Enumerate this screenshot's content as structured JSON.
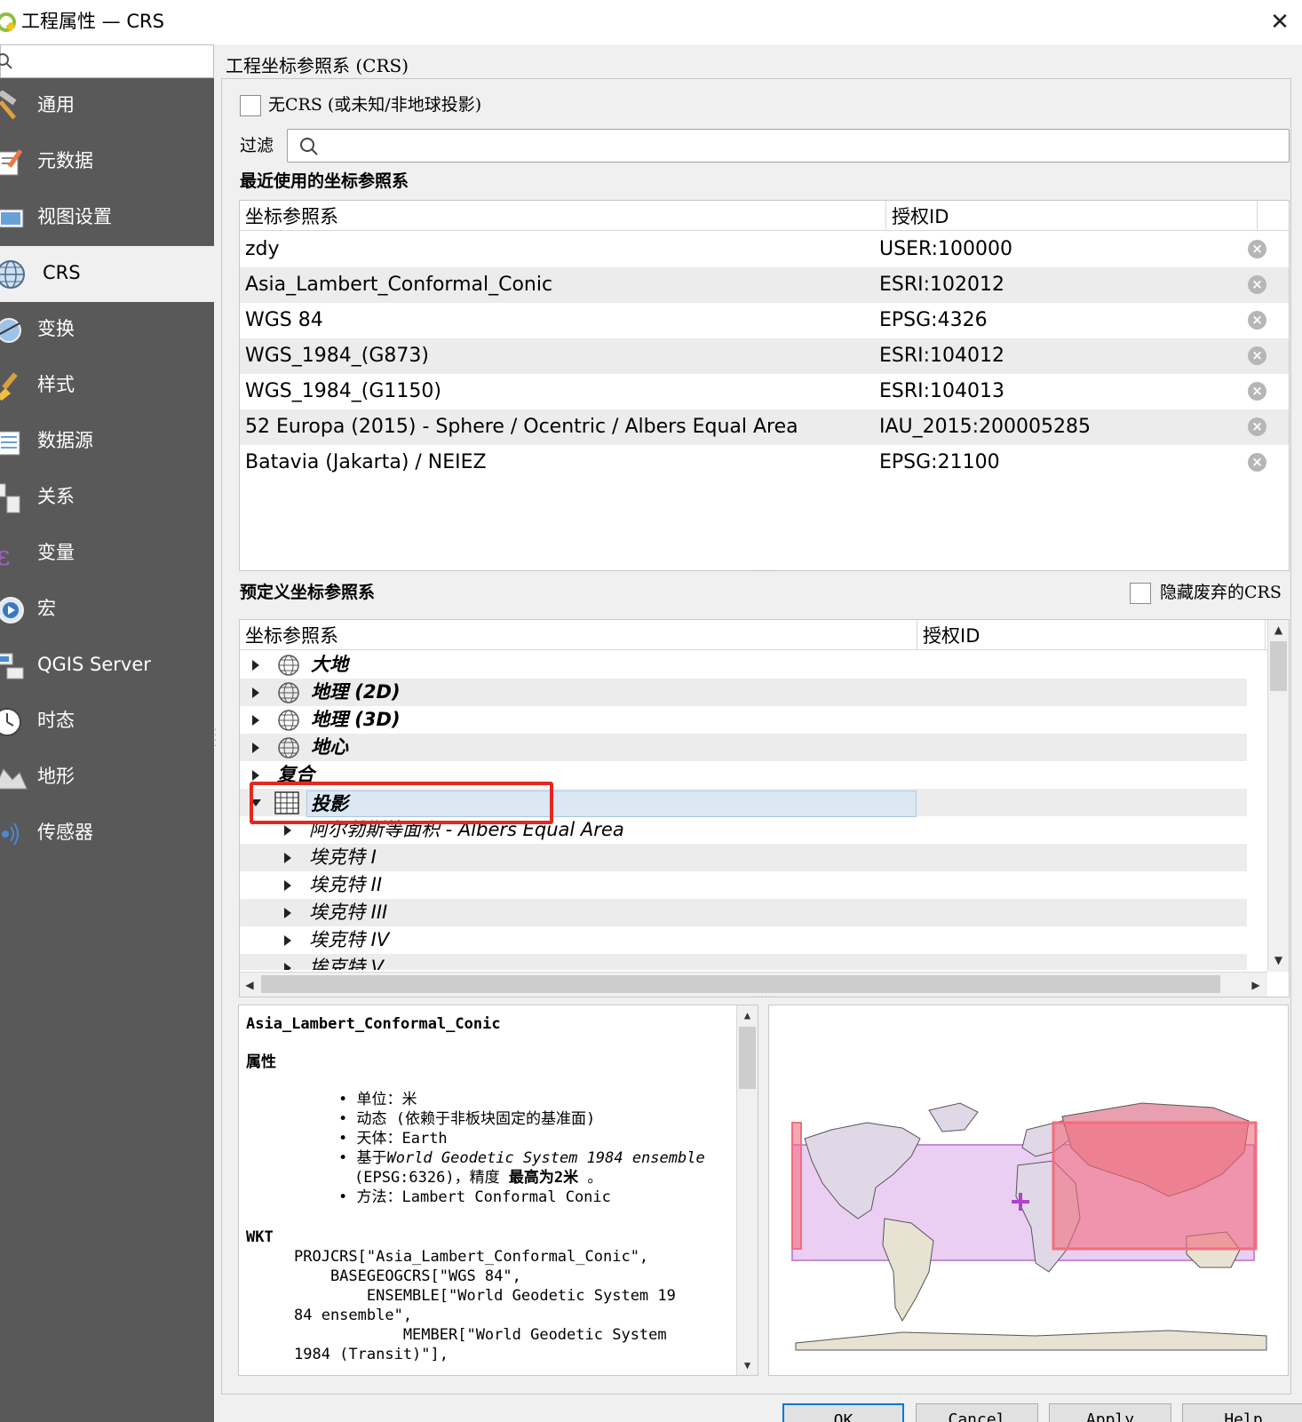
{
  "window": {
    "title": "工程属性 — CRS",
    "close_glyph": "✕"
  },
  "sidebar": {
    "items": [
      {
        "label": "通用",
        "icon": "hammer-icon"
      },
      {
        "label": "元数据",
        "icon": "metadata-icon"
      },
      {
        "label": "视图设置",
        "icon": "view-settings-icon"
      },
      {
        "label": "CRS",
        "icon": "globe-icon"
      },
      {
        "label": "变换",
        "icon": "transform-icon"
      },
      {
        "label": "样式",
        "icon": "paintbrush-icon"
      },
      {
        "label": "数据源",
        "icon": "datasource-icon"
      },
      {
        "label": "关系",
        "icon": "relations-icon"
      },
      {
        "label": "变量",
        "icon": "variable-icon"
      },
      {
        "label": "宏",
        "icon": "macro-icon"
      },
      {
        "label": "QGIS Server",
        "icon": "server-icon"
      },
      {
        "label": "时态",
        "icon": "clock-icon"
      },
      {
        "label": "地形",
        "icon": "terrain-icon"
      },
      {
        "label": "传感器",
        "icon": "sensor-icon"
      }
    ],
    "selected": "CRS"
  },
  "crs_page": {
    "section_title": "工程坐标参照系 (CRS)",
    "no_crs_label": "无CRS (或未知/非地球投影)",
    "filter_label": "过滤",
    "filter_value": "",
    "recent_title": "最近使用的坐标参照系",
    "recent_columns": [
      "坐标参照系",
      "授权ID"
    ],
    "recent_rows": [
      {
        "name": "zdy",
        "id": "USER:100000"
      },
      {
        "name": "Asia_Lambert_Conformal_Conic",
        "id": "ESRI:102012"
      },
      {
        "name": "WGS 84",
        "id": "EPSG:4326"
      },
      {
        "name": "WGS_1984_(G873)",
        "id": "ESRI:104012"
      },
      {
        "name": "WGS_1984_(G1150)",
        "id": "ESRI:104013"
      },
      {
        "name": "52 Europa (2015) - Sphere / Ocentric / Albers Equal Area",
        "id": "IAU_2015:200005285"
      },
      {
        "name": "Batavia (Jakarta) / NEIEZ",
        "id": "EPSG:21100"
      }
    ],
    "predefined_title": "预定义坐标参照系",
    "hide_deprecated_label": "隐藏废弃的CRS",
    "predefined_columns": [
      "坐标参照系",
      "授权ID"
    ],
    "tree": [
      {
        "label": "大地",
        "level": 0,
        "expanded": false,
        "icon": "globe-icon"
      },
      {
        "label": "地理 (2D)",
        "level": 0,
        "expanded": false,
        "icon": "globe-icon"
      },
      {
        "label": "地理 (3D)",
        "level": 0,
        "expanded": false,
        "icon": "globe-icon"
      },
      {
        "label": "地心",
        "level": 0,
        "expanded": false,
        "icon": "globe-icon"
      },
      {
        "label": "复合",
        "level": 0,
        "expanded": false,
        "icon": ""
      },
      {
        "label": "投影",
        "level": 0,
        "expanded": true,
        "icon": "grid-icon"
      },
      {
        "label": "阿尔勃斯等面积 - Albers Equal Area",
        "level": 1,
        "expanded": false,
        "icon": ""
      },
      {
        "label": "埃克特 I",
        "level": 1,
        "expanded": false,
        "icon": ""
      },
      {
        "label": "埃克特 II",
        "level": 1,
        "expanded": false,
        "icon": ""
      },
      {
        "label": "埃克特 III",
        "level": 1,
        "expanded": false,
        "icon": ""
      },
      {
        "label": "埃克特 IV",
        "level": 1,
        "expanded": false,
        "icon": ""
      },
      {
        "label": "埃克特 V",
        "level": 1,
        "expanded": false,
        "icon": ""
      }
    ],
    "details": {
      "name": "Asia_Lambert_Conformal_Conic",
      "props_title": "属性",
      "unit": "单位：米",
      "dynamic": "动态 (依赖于非板块固定的基准面)",
      "celestial": "天体：Earth",
      "based_on_prefix": "基于",
      "based_on_italic": "World Geodetic System 1984 ensemble",
      "accuracy_prefix": "(EPSG:6326)，精度",
      "accuracy_bold": "最高为2米",
      "accuracy_suffix": "。",
      "method": "方法：Lambert Conformal Conic",
      "wkt_title": "WKT",
      "wkt_lines": [
        "PROJCRS[\"Asia_Lambert_Conformal_Conic\",",
        "    BASEGEOGCRS[\"WGS 84\",",
        "        ENSEMBLE[\"World Geodetic System 19",
        "84 ensemble\",",
        "            MEMBER[\"World Geodetic System",
        "1984 (Transit)\"],"
      ]
    }
  },
  "buttons": {
    "ok": "OK",
    "cancel": "Cancel",
    "apply": "Apply",
    "help": "Help"
  },
  "colors": {
    "sidebar_bg": "#595959",
    "highlight": "#e8261f",
    "extent_fill": "#f26d7d",
    "world_extent": "#d9a8e8",
    "map_land": "#e8e2d2"
  }
}
